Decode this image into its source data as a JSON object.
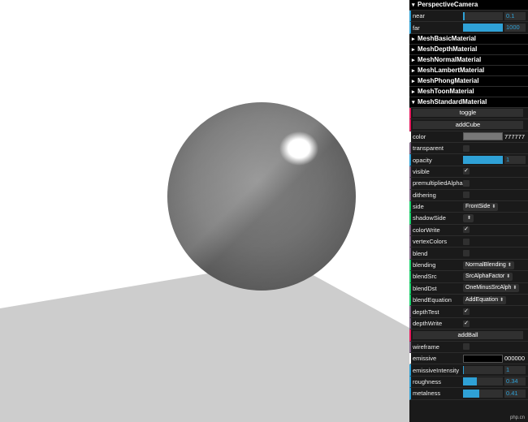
{
  "gui": {
    "camera_folder": "PerspectiveCamera",
    "near": {
      "label": "near",
      "value": "0.1",
      "fraction": 0.0
    },
    "far": {
      "label": "far",
      "value": "1000",
      "fraction": 1.0
    },
    "collapsed_folders": [
      "MeshBasicMaterial",
      "MeshDepthMaterial",
      "MeshNormalMaterial",
      "MeshLambertMaterial",
      "MeshPhongMaterial",
      "MeshToonMaterial"
    ],
    "standard_folder": "MeshStandardMaterial",
    "toggle_label": "toggle",
    "add_cube_label": "addCube",
    "color": {
      "label": "color",
      "value": "777777",
      "hex": "#777777"
    },
    "transparent": {
      "label": "transparent",
      "checked": false
    },
    "opacity": {
      "label": "opacity",
      "value": "1",
      "fraction": 1.0
    },
    "visible": {
      "label": "visible",
      "checked": true
    },
    "premultipliedAlpha": {
      "label": "premultipliedAlpha",
      "checked": false
    },
    "dithering": {
      "label": "dithering",
      "checked": false
    },
    "side": {
      "label": "side",
      "value": "FrontSide"
    },
    "shadowSide": {
      "label": "shadowSide",
      "value": ""
    },
    "colorWrite": {
      "label": "colorWrite",
      "checked": true
    },
    "vertexColors": {
      "label": "vertexColors",
      "checked": false
    },
    "blend": {
      "label": "blend",
      "checked": false
    },
    "blending": {
      "label": "blending",
      "value": "NormalBlending"
    },
    "blendSrc": {
      "label": "blendSrc",
      "value": "SrcAlphaFactor"
    },
    "blendDst": {
      "label": "blendDst",
      "value": "OneMinusSrcAlph"
    },
    "blendEquation": {
      "label": "blendEquation",
      "value": "AddEquation"
    },
    "depthTest": {
      "label": "depthTest",
      "checked": true
    },
    "depthWrite": {
      "label": "depthWrite",
      "checked": true
    },
    "add_ball_label": "addBall",
    "wireframe": {
      "label": "wireframe",
      "checked": false
    },
    "emissive": {
      "label": "emissive",
      "value": "000000",
      "hex": "#000000"
    },
    "emissiveIntensity": {
      "label": "emissiveIntensity",
      "value": "1",
      "fraction": 0.02
    },
    "roughness": {
      "label": "roughness",
      "value": "0.34",
      "fraction": 0.34
    },
    "metalness": {
      "label": "metalness",
      "value": "0.41",
      "fraction": 0.41
    }
  },
  "scene": {
    "background": "#ffffff",
    "floor_color": "#cdcdcd",
    "sphere_color": "#7b7b7b",
    "highlight_color": "#ffffff"
  },
  "colors": {
    "panel_bg": "#1a1a1a",
    "number_accent": "#2fa1d6"
  },
  "icons": {
    "caret_open": "caret-down-icon",
    "caret_closed": "caret-right-icon",
    "checkmark": "checkmark-icon"
  },
  "watermark": "php.cn"
}
